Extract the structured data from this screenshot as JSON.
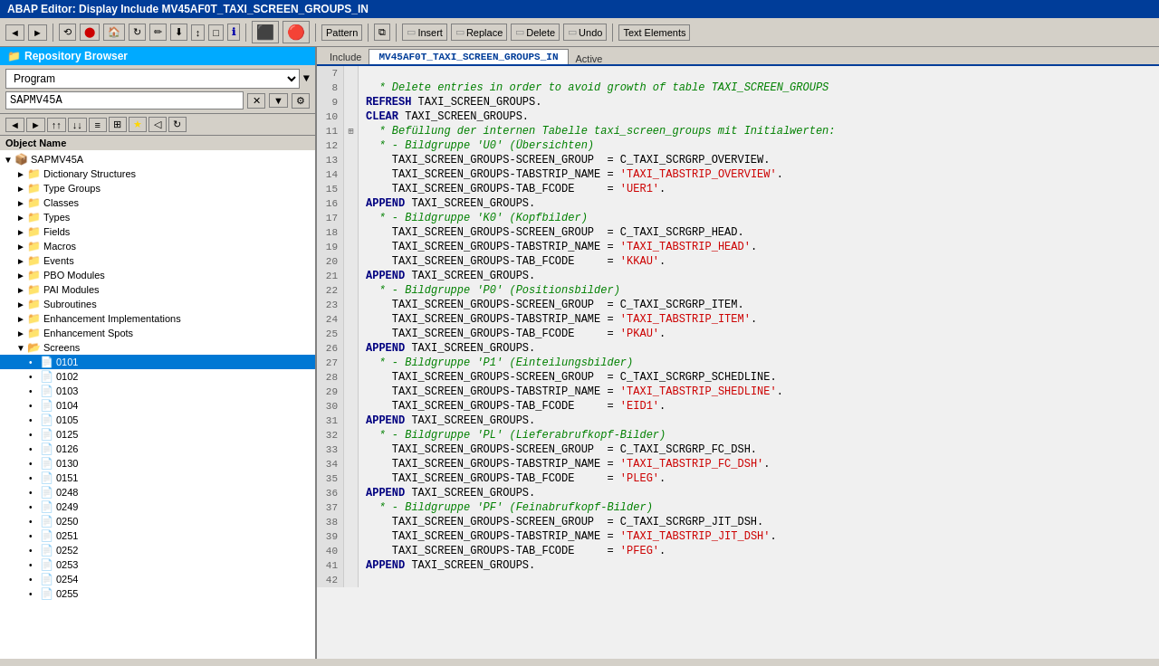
{
  "title": "ABAP Editor: Display Include MV45AF0T_TAXI_SCREEN_GROUPS_IN",
  "toolbar": {
    "back_label": "←",
    "forward_label": "→",
    "pattern_label": "Pattern",
    "insert_label": "Insert",
    "replace_label": "Replace",
    "delete_label": "Delete",
    "undo_label": "Undo",
    "text_elements_label": "Text Elements"
  },
  "repo_browser": {
    "title": "Repository Browser",
    "program_type": "Program",
    "program_name": "SAPMV45A",
    "object_name_label": "Object Name"
  },
  "editor": {
    "tab_label": "Include",
    "file_name": "MV45AF0T_TAXI_SCREEN_GROUPS_IN",
    "status": "Active"
  },
  "tree_items": [
    {
      "id": "sapmv45a",
      "label": "SAPMV45A",
      "level": 0,
      "type": "program",
      "expanded": true
    },
    {
      "id": "dict-structures",
      "label": "Dictionary Structures",
      "level": 1,
      "type": "folder",
      "expanded": false
    },
    {
      "id": "type-groups",
      "label": "Type Groups",
      "level": 1,
      "type": "folder",
      "expanded": false
    },
    {
      "id": "classes",
      "label": "Classes",
      "level": 1,
      "type": "folder",
      "expanded": false
    },
    {
      "id": "types",
      "label": "Types",
      "level": 1,
      "type": "folder",
      "expanded": false
    },
    {
      "id": "fields",
      "label": "Fields",
      "level": 1,
      "type": "folder",
      "expanded": false
    },
    {
      "id": "macros",
      "label": "Macros",
      "level": 1,
      "type": "folder",
      "expanded": false
    },
    {
      "id": "events",
      "label": "Events",
      "level": 1,
      "type": "folder",
      "expanded": false
    },
    {
      "id": "pbo-modules",
      "label": "PBO Modules",
      "level": 1,
      "type": "folder",
      "expanded": false
    },
    {
      "id": "pai-modules",
      "label": "PAI Modules",
      "level": 1,
      "type": "folder",
      "expanded": false
    },
    {
      "id": "subroutines",
      "label": "Subroutines",
      "level": 1,
      "type": "folder",
      "expanded": false
    },
    {
      "id": "enhancement-impl",
      "label": "Enhancement Implementations",
      "level": 1,
      "type": "folder",
      "expanded": false
    },
    {
      "id": "enhancement-spots",
      "label": "Enhancement Spots",
      "level": 1,
      "type": "folder",
      "expanded": false
    },
    {
      "id": "screens",
      "label": "Screens",
      "level": 1,
      "type": "folder",
      "expanded": true
    },
    {
      "id": "0101",
      "label": "0101",
      "level": 2,
      "type": "screen",
      "expanded": false,
      "selected": true
    },
    {
      "id": "0102",
      "label": "0102",
      "level": 2,
      "type": "screen",
      "expanded": false
    },
    {
      "id": "0103",
      "label": "0103",
      "level": 2,
      "type": "screen",
      "expanded": false
    },
    {
      "id": "0104",
      "label": "0104",
      "level": 2,
      "type": "screen",
      "expanded": false
    },
    {
      "id": "0105",
      "label": "0105",
      "level": 2,
      "type": "screen",
      "expanded": false
    },
    {
      "id": "0125",
      "label": "0125",
      "level": 2,
      "type": "screen",
      "expanded": false
    },
    {
      "id": "0126",
      "label": "0126",
      "level": 2,
      "type": "screen",
      "expanded": false
    },
    {
      "id": "0130",
      "label": "0130",
      "level": 2,
      "type": "screen",
      "expanded": false
    },
    {
      "id": "0151",
      "label": "0151",
      "level": 2,
      "type": "screen",
      "expanded": false
    },
    {
      "id": "0248",
      "label": "0248",
      "level": 2,
      "type": "screen",
      "expanded": false
    },
    {
      "id": "0249",
      "label": "0249",
      "level": 2,
      "type": "screen",
      "expanded": false
    },
    {
      "id": "0250",
      "label": "0250",
      "level": 2,
      "type": "screen",
      "expanded": false
    },
    {
      "id": "0251",
      "label": "0251",
      "level": 2,
      "type": "screen",
      "expanded": false
    },
    {
      "id": "0252",
      "label": "0252",
      "level": 2,
      "type": "screen",
      "expanded": false
    },
    {
      "id": "0253",
      "label": "0253",
      "level": 2,
      "type": "screen",
      "expanded": false
    },
    {
      "id": "0254",
      "label": "0254",
      "level": 2,
      "type": "screen",
      "expanded": false
    },
    {
      "id": "0255",
      "label": "0255",
      "level": 2,
      "type": "screen",
      "expanded": false
    }
  ],
  "code_lines": [
    {
      "num": 7,
      "expand": false,
      "content": "",
      "type": "normal"
    },
    {
      "num": 8,
      "expand": false,
      "content": "  * Delete entries in order to avoid growth of table TAXI_SCREEN_GROUPS",
      "type": "comment"
    },
    {
      "num": 9,
      "expand": false,
      "content": "    REFRESH TAXI_SCREEN_GROUPS.",
      "type": "kw_line"
    },
    {
      "num": 10,
      "expand": false,
      "content": "    CLEAR TAXI_SCREEN_GROUPS.",
      "type": "kw_line"
    },
    {
      "num": 11,
      "expand": true,
      "content": "  * Befüllung der internen Tabelle taxi_screen_groups mit Initialwerten:",
      "type": "comment"
    },
    {
      "num": 12,
      "expand": false,
      "content": "  * - Bildgruppe 'U0' (Übersichten)",
      "type": "comment"
    },
    {
      "num": 13,
      "expand": false,
      "content": "    TAXI_SCREEN_GROUPS-SCREEN_GROUP  = C_TAXI_SCRGRP_OVERVIEW.",
      "type": "normal"
    },
    {
      "num": 14,
      "expand": false,
      "content": "    TAXI_SCREEN_GROUPS-TABSTRIP_NAME = 'TAXI_TABSTRIP_OVERVIEW'.",
      "type": "normal_string"
    },
    {
      "num": 15,
      "expand": false,
      "content": "    TAXI_SCREEN_GROUPS-TAB_FCODE     = 'UER1'.",
      "type": "normal_string"
    },
    {
      "num": 16,
      "expand": false,
      "content": "    APPEND TAXI_SCREEN_GROUPS.",
      "type": "kw_line"
    },
    {
      "num": 17,
      "expand": false,
      "content": "  * - Bildgruppe 'K0' (Kopfbilder)",
      "type": "comment"
    },
    {
      "num": 18,
      "expand": false,
      "content": "    TAXI_SCREEN_GROUPS-SCREEN_GROUP  = C_TAXI_SCRGRP_HEAD.",
      "type": "normal"
    },
    {
      "num": 19,
      "expand": false,
      "content": "    TAXI_SCREEN_GROUPS-TABSTRIP_NAME = 'TAXI_TABSTRIP_HEAD'.",
      "type": "normal_string"
    },
    {
      "num": 20,
      "expand": false,
      "content": "    TAXI_SCREEN_GROUPS-TAB_FCODE     = 'KKAU'.",
      "type": "normal_string"
    },
    {
      "num": 21,
      "expand": false,
      "content": "    APPEND TAXI_SCREEN_GROUPS.",
      "type": "kw_line"
    },
    {
      "num": 22,
      "expand": false,
      "content": "  * - Bildgruppe 'P0' (Positionsbilder)",
      "type": "comment"
    },
    {
      "num": 23,
      "expand": false,
      "content": "    TAXI_SCREEN_GROUPS-SCREEN_GROUP  = C_TAXI_SCRGRP_ITEM.",
      "type": "normal"
    },
    {
      "num": 24,
      "expand": false,
      "content": "    TAXI_SCREEN_GROUPS-TABSTRIP_NAME = 'TAXI_TABSTRIP_ITEM'.",
      "type": "normal_string"
    },
    {
      "num": 25,
      "expand": false,
      "content": "    TAXI_SCREEN_GROUPS-TAB_FCODE     = 'PKAU'.",
      "type": "normal_string"
    },
    {
      "num": 26,
      "expand": false,
      "content": "    APPEND TAXI_SCREEN_GROUPS.",
      "type": "kw_line"
    },
    {
      "num": 27,
      "expand": false,
      "content": "  * - Bildgruppe 'P1' (Einteilungsbilder)",
      "type": "comment"
    },
    {
      "num": 28,
      "expand": false,
      "content": "    TAXI_SCREEN_GROUPS-SCREEN_GROUP  = C_TAXI_SCRGRP_SCHEDLINE.",
      "type": "normal"
    },
    {
      "num": 29,
      "expand": false,
      "content": "    TAXI_SCREEN_GROUPS-TABSTRIP_NAME = 'TAXI_TABSTRIP_SHEDLINE'.",
      "type": "normal_string"
    },
    {
      "num": 30,
      "expand": false,
      "content": "    TAXI_SCREEN_GROUPS-TAB_FCODE     = 'EID1'.",
      "type": "normal_string"
    },
    {
      "num": 31,
      "expand": false,
      "content": "    APPEND TAXI_SCREEN_GROUPS.",
      "type": "kw_line"
    },
    {
      "num": 32,
      "expand": false,
      "content": "  * - Bildgruppe 'PL' (Lieferabrufkopf-Bilder)",
      "type": "comment"
    },
    {
      "num": 33,
      "expand": false,
      "content": "    TAXI_SCREEN_GROUPS-SCREEN_GROUP  = C_TAXI_SCRGRP_FC_DSH.",
      "type": "normal"
    },
    {
      "num": 34,
      "expand": false,
      "content": "    TAXI_SCREEN_GROUPS-TABSTRIP_NAME = 'TAXI_TABSTRIP_FC_DSH'.",
      "type": "normal_string"
    },
    {
      "num": 35,
      "expand": false,
      "content": "    TAXI_SCREEN_GROUPS-TAB_FCODE     = 'PLEG'.",
      "type": "normal_string"
    },
    {
      "num": 36,
      "expand": false,
      "content": "    APPEND TAXI_SCREEN_GROUPS.",
      "type": "kw_line"
    },
    {
      "num": 37,
      "expand": false,
      "content": "  * - Bildgruppe 'PF' (Feinabrufkopf-Bilder)",
      "type": "comment"
    },
    {
      "num": 38,
      "expand": false,
      "content": "    TAXI_SCREEN_GROUPS-SCREEN_GROUP  = C_TAXI_SCRGRP_JIT_DSH.",
      "type": "normal"
    },
    {
      "num": 39,
      "expand": false,
      "content": "    TAXI_SCREEN_GROUPS-TABSTRIP_NAME = 'TAXI_TABSTRIP_JIT_DSH'.",
      "type": "normal_string"
    },
    {
      "num": 40,
      "expand": false,
      "content": "    TAXI_SCREEN_GROUPS-TAB_FCODE     = 'PFEG'.",
      "type": "normal_string"
    },
    {
      "num": 41,
      "expand": false,
      "content": "    APPEND TAXI_SCREEN_GROUPS.",
      "type": "kw_line"
    },
    {
      "num": 42,
      "expand": false,
      "content": "",
      "type": "normal"
    }
  ]
}
